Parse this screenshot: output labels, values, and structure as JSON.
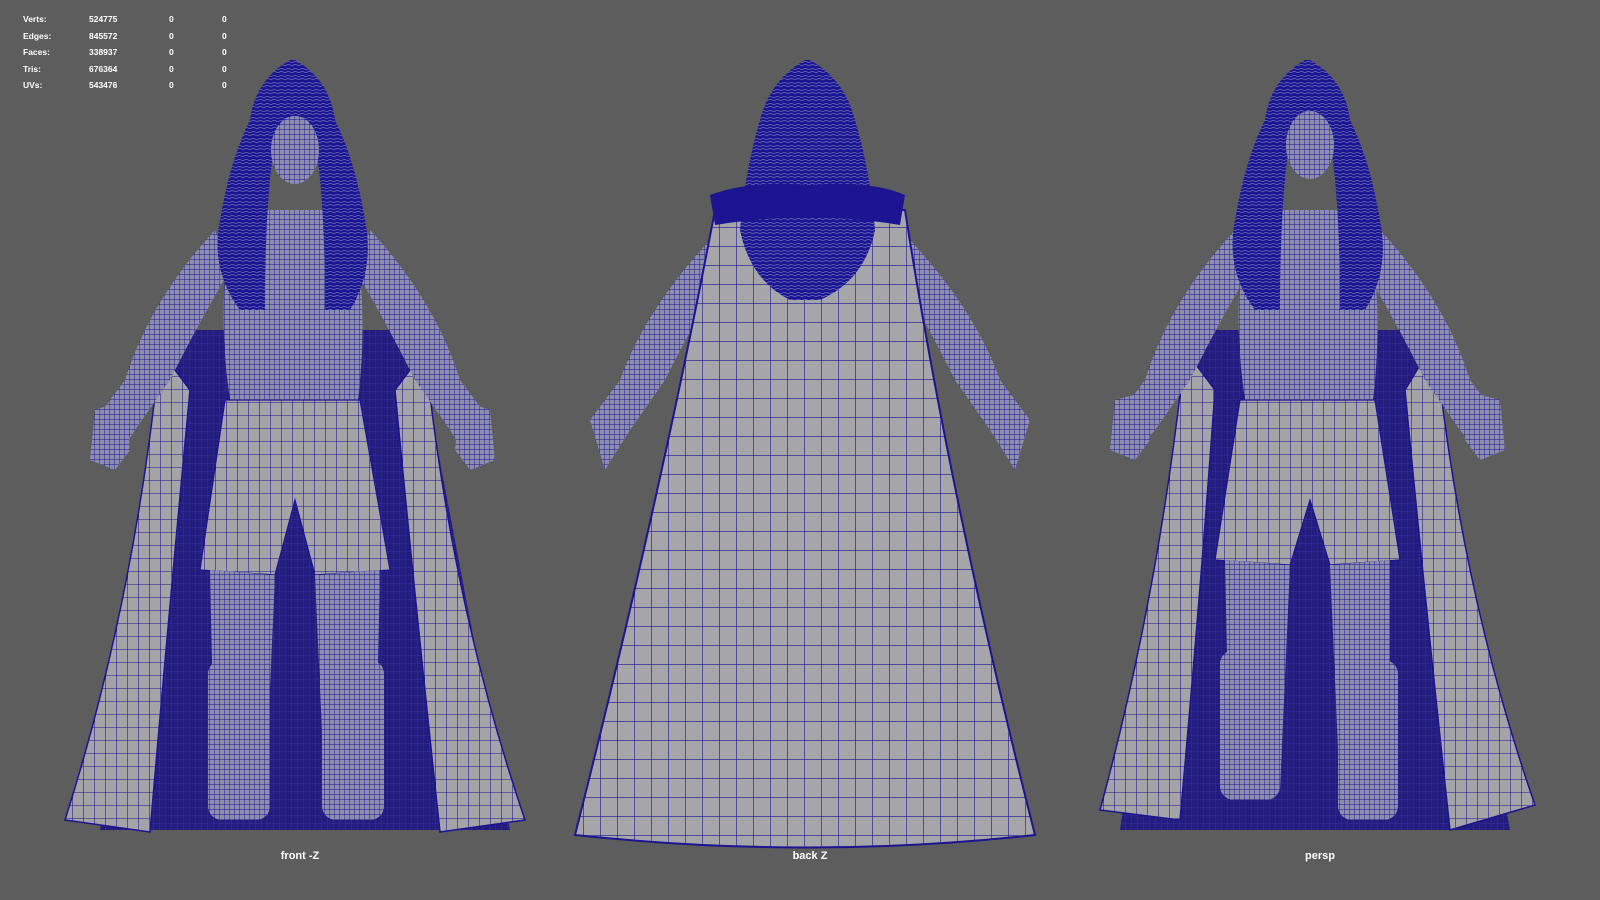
{
  "heads_up_display": {
    "rows": [
      {
        "label": "Verts:",
        "value": "524775",
        "selected": "0",
        "component": "0"
      },
      {
        "label": "Edges:",
        "value": "845572",
        "selected": "0",
        "component": "0"
      },
      {
        "label": "Faces:",
        "value": "338937",
        "selected": "0",
        "component": "0"
      },
      {
        "label": "Tris:",
        "value": "676364",
        "selected": "0",
        "component": "0"
      },
      {
        "label": "UVs:",
        "value": "543476",
        "selected": "0",
        "component": "0"
      }
    ]
  },
  "viewports": [
    {
      "camera": "front -Z",
      "view": "front"
    },
    {
      "camera": "back Z",
      "view": "back"
    },
    {
      "camera": "persp",
      "view": "persp"
    }
  ],
  "colors": {
    "background": "#5d5d5d",
    "wireframe": "#1c1490",
    "surface": "#a4a4a8",
    "shadow": "#2a2578",
    "hud_text": "#ffffff"
  }
}
